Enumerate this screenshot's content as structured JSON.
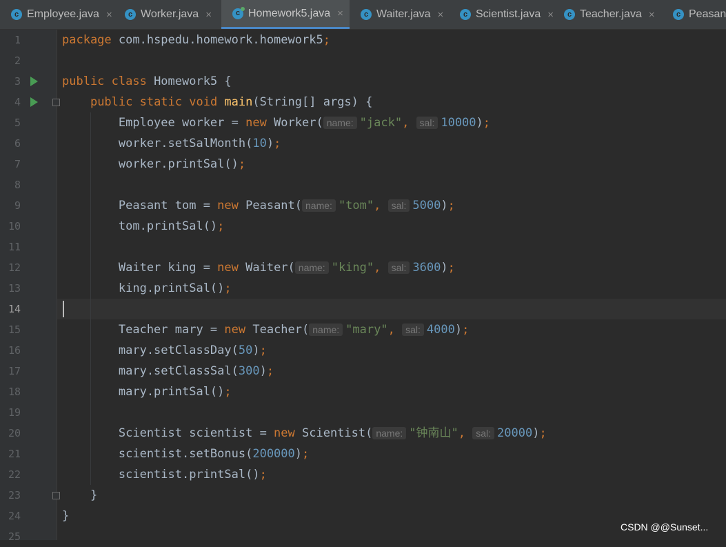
{
  "tabs": [
    {
      "label": "Employee.java",
      "icon": "class-icon",
      "icon_letter": "c",
      "close": "×"
    },
    {
      "label": "Worker.java",
      "icon": "class-icon",
      "icon_letter": "c",
      "close": "×"
    },
    {
      "label": "Homework5.java",
      "icon": "class-icon",
      "icon_letter": "c",
      "close": "×",
      "active": true
    },
    {
      "label": "Waiter.java",
      "icon": "class-icon",
      "icon_letter": "c",
      "close": "×"
    },
    {
      "label": "Scientist.java",
      "icon": "class-icon",
      "icon_letter": "c",
      "close": "×"
    },
    {
      "label": "Teacher.java",
      "icon": "class-icon",
      "icon_letter": "c",
      "close": "×"
    },
    {
      "label": "Peasant.",
      "icon": "class-icon",
      "icon_letter": "c"
    }
  ],
  "editor": {
    "current_line": 14,
    "lines": [
      [
        [
          "kw",
          "package "
        ],
        [
          "p",
          "com.hspedu.homework.homework5"
        ],
        [
          "kw",
          ";"
        ]
      ],
      [],
      [
        [
          "kw",
          "public class "
        ],
        [
          "p",
          "Homework5 {"
        ]
      ],
      [
        [
          "p",
          "    "
        ],
        [
          "kw",
          "public static void "
        ],
        [
          "fn",
          "main"
        ],
        [
          "p",
          "(String[] args) {"
        ]
      ],
      [
        [
          "p",
          "        Employee worker = "
        ],
        [
          "kw",
          "new "
        ],
        [
          "p",
          "Worker("
        ],
        [
          "hint",
          "name:"
        ],
        [
          "str",
          "\"jack\""
        ],
        [
          "kw",
          ", "
        ],
        [
          "hint",
          "sal:"
        ],
        [
          "num",
          "10000"
        ],
        [
          "p",
          ")"
        ],
        [
          "kw",
          ";"
        ]
      ],
      [
        [
          "p",
          "        worker.setSalMonth("
        ],
        [
          "num",
          "10"
        ],
        [
          "p",
          ")"
        ],
        [
          "kw",
          ";"
        ]
      ],
      [
        [
          "p",
          "        worker.printSal()"
        ],
        [
          "kw",
          ";"
        ]
      ],
      [],
      [
        [
          "p",
          "        Peasant tom = "
        ],
        [
          "kw",
          "new "
        ],
        [
          "p",
          "Peasant("
        ],
        [
          "hint",
          "name:"
        ],
        [
          "str",
          "\"tom\""
        ],
        [
          "kw",
          ", "
        ],
        [
          "hint",
          "sal:"
        ],
        [
          "num",
          "5000"
        ],
        [
          "p",
          ")"
        ],
        [
          "kw",
          ";"
        ]
      ],
      [
        [
          "p",
          "        tom.printSal()"
        ],
        [
          "kw",
          ";"
        ]
      ],
      [],
      [
        [
          "p",
          "        Waiter king = "
        ],
        [
          "kw",
          "new "
        ],
        [
          "p",
          "Waiter("
        ],
        [
          "hint",
          "name:"
        ],
        [
          "str",
          "\"king\""
        ],
        [
          "kw",
          ", "
        ],
        [
          "hint",
          "sal:"
        ],
        [
          "num",
          "3600"
        ],
        [
          "p",
          ")"
        ],
        [
          "kw",
          ";"
        ]
      ],
      [
        [
          "p",
          "        king.printSal()"
        ],
        [
          "kw",
          ";"
        ]
      ],
      [],
      [
        [
          "p",
          "        Teacher mary = "
        ],
        [
          "kw",
          "new "
        ],
        [
          "p",
          "Teacher("
        ],
        [
          "hint",
          "name:"
        ],
        [
          "str",
          "\"mary\""
        ],
        [
          "kw",
          ", "
        ],
        [
          "hint",
          "sal:"
        ],
        [
          "num",
          "4000"
        ],
        [
          "p",
          ")"
        ],
        [
          "kw",
          ";"
        ]
      ],
      [
        [
          "p",
          "        mary.setClassDay("
        ],
        [
          "num",
          "50"
        ],
        [
          "p",
          ")"
        ],
        [
          "kw",
          ";"
        ]
      ],
      [
        [
          "p",
          "        mary.setClassSal("
        ],
        [
          "num",
          "300"
        ],
        [
          "p",
          ")"
        ],
        [
          "kw",
          ";"
        ]
      ],
      [
        [
          "p",
          "        mary.printSal()"
        ],
        [
          "kw",
          ";"
        ]
      ],
      [],
      [
        [
          "p",
          "        Scientist scientist = "
        ],
        [
          "kw",
          "new "
        ],
        [
          "p",
          "Scientist("
        ],
        [
          "hint",
          "name:"
        ],
        [
          "str",
          "\"钟南山\""
        ],
        [
          "kw",
          ", "
        ],
        [
          "hint",
          "sal:"
        ],
        [
          "num",
          "20000"
        ],
        [
          "p",
          ")"
        ],
        [
          "kw",
          ";"
        ]
      ],
      [
        [
          "p",
          "        scientist.setBonus("
        ],
        [
          "num",
          "200000"
        ],
        [
          "p",
          ")"
        ],
        [
          "kw",
          ";"
        ]
      ],
      [
        [
          "p",
          "        scientist.printSal()"
        ],
        [
          "kw",
          ";"
        ]
      ],
      [
        [
          "p",
          "    }"
        ]
      ],
      [
        [
          "p",
          "}"
        ]
      ],
      []
    ],
    "run_lines": [
      3,
      4
    ],
    "fold_lines": [
      4,
      23
    ]
  },
  "watermark": "CSDN @@Sunset..."
}
